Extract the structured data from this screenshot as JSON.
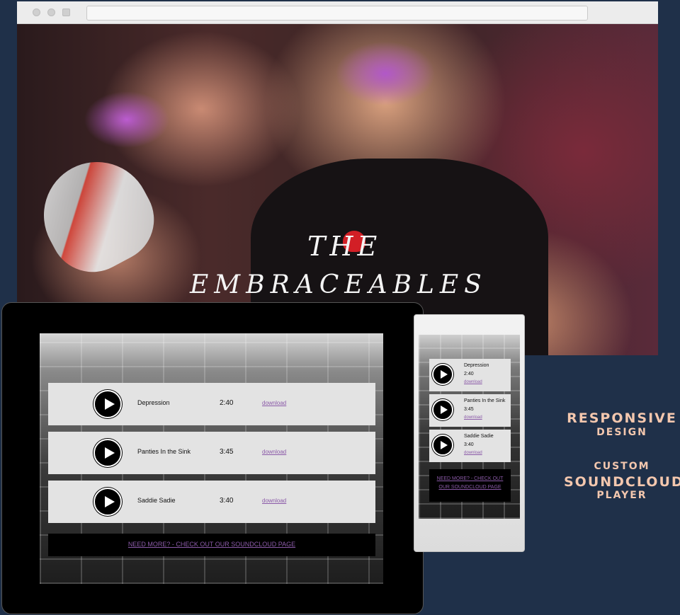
{
  "hero": {
    "title_line1": "THE",
    "title_line2": "EMBRACEABLES"
  },
  "tracks": [
    {
      "name": "Depression",
      "time": "2:40",
      "download": "download"
    },
    {
      "name": "Panties In the Sink",
      "time": "3:45",
      "download": "download"
    },
    {
      "name": "Saddie Sadie",
      "time": "3:40",
      "download": "download"
    }
  ],
  "tablet": {
    "more_link": "NEED MORE? - CHECK OUT OUR SOUNDCLOUD PAGE"
  },
  "phone": {
    "more_link_line1": "NEED MORE? - CHECK OUT",
    "more_link_line2": "OUR SOUNDCLOUD PAGE"
  },
  "captions": {
    "responsive": "RESPONSIVE",
    "design": "DESIGN",
    "custom": "CUSTOM",
    "soundcloud": "SOUNDCLOUD",
    "player": "PLAYER"
  },
  "colors": {
    "background": "#1f3049",
    "caption": "#f3c7ae",
    "link_purple": "#8b5aa8"
  },
  "icons": [
    "play-icon"
  ]
}
